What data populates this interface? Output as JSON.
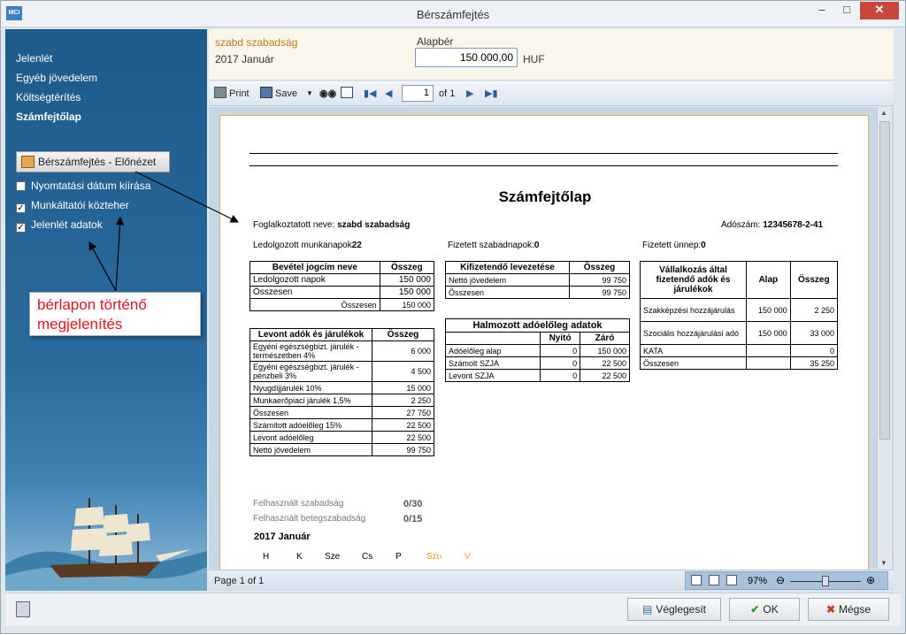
{
  "window": {
    "title": "Bérszámfejtés",
    "logo": "MCI"
  },
  "sidebar": {
    "items": [
      {
        "label": "Jelenlét",
        "active": false
      },
      {
        "label": "Egyéb jövedelem",
        "active": false
      },
      {
        "label": "Költségtérítés",
        "active": false
      },
      {
        "label": "Számfejtőlap",
        "active": true
      }
    ],
    "preview_button": "Bérszámfejtés - Előnézet",
    "checkboxes": [
      {
        "label": "Nyomtatási dátum kiírása",
        "checked": false
      },
      {
        "label": "Munkáltatói közteher",
        "checked": true
      },
      {
        "label": "Jelenlét adatok",
        "checked": true
      }
    ],
    "callout": "bérlapon történő megjelenítés"
  },
  "header": {
    "employee": "szabd szabadság",
    "period": "2017 Január",
    "alapber_label": "Alapbér",
    "alapber_value": "150 000,00",
    "currency": "HUF"
  },
  "toolbar": {
    "print": "Print",
    "save": "Save",
    "page_current": "1",
    "page_of": "of 1"
  },
  "report": {
    "title": "Számfejtőlap",
    "employee_label": "Foglalkoztatott neve:",
    "employee_name": "szabd szabadság",
    "tax_label": "Adószám:",
    "tax_number": "12345678-2-41",
    "worked_label": "Ledolgozott munkanapok",
    "worked_value": "22",
    "paid_leave_label": "Fizetett szabadnapok:",
    "paid_leave_value": "0",
    "paid_holiday_label": "Fizetett ünnep:",
    "paid_holiday_value": "0",
    "income_table": {
      "headers": [
        "Bevétel jogcím neve",
        "Összeg"
      ],
      "rows": [
        [
          "Ledolgozott napok",
          "150 000"
        ],
        [
          "Összesen",
          "150 000"
        ]
      ],
      "total_label": "Összesen",
      "total_value": "150 000"
    },
    "deductions_table": {
      "headers": [
        "Levont adók és járulékok",
        "Összeg"
      ],
      "rows": [
        [
          "Egyéni egészségbizt. járulék - természetben 4%",
          "6 000"
        ],
        [
          "Egyéni egészségbizt. járulék - pénzbeli 3%",
          "4 500"
        ],
        [
          "Nyugdíjjárulék 10%",
          "15 000"
        ],
        [
          "Munkaerőpiaci járulék 1,5%",
          "2 250"
        ],
        [
          "Összesen",
          "27 750"
        ],
        [
          "Számított adóelőleg 15%",
          "22 500"
        ],
        [
          "Levont adóelőleg",
          "22 500"
        ],
        [
          "Nettó jövedelem",
          "99 750"
        ]
      ]
    },
    "payout_table": {
      "headers": [
        "Kifizetendő levezetése",
        "Összeg"
      ],
      "rows": [
        [
          "Nettó jövedelem",
          "99 750"
        ],
        [
          "Összesen",
          "99 750"
        ]
      ]
    },
    "advance_table": {
      "title": "Halmozott adóelőleg adatok",
      "headers": [
        "",
        "Nyitó",
        "Záró"
      ],
      "rows": [
        [
          "Adóelőleg alap",
          "0",
          "150 000"
        ],
        [
          "Számolt SZJA",
          "0",
          "22 500"
        ],
        [
          "Levont SZJA",
          "0",
          "22 500"
        ]
      ]
    },
    "employer_table": {
      "headers": [
        "Vállalkozás által fizetendő adók és járulékok",
        "Alap",
        "Összeg"
      ],
      "rows": [
        [
          "Szakképzési hozzájárulás",
          "150 000",
          "2 250"
        ],
        [
          "Szociális hozzájárulási adó",
          "150 000",
          "33 000"
        ],
        [
          "KATA",
          "",
          "0"
        ],
        [
          "Összesen",
          "",
          "35 250"
        ]
      ]
    },
    "used_leave_label": "Felhasznált szabadság",
    "used_leave_value": "0/30",
    "used_sick_label": "Felhasznált betegszabadság",
    "used_sick_value": "0/15",
    "calendar_month": "2017 Január",
    "calendar_days": [
      "H",
      "K",
      "Sze",
      "Cs",
      "P",
      "Szo",
      "V"
    ]
  },
  "statusbar": {
    "page": "Page 1 of 1",
    "zoom": "97%"
  },
  "footer": {
    "finalize": "Véglegesít",
    "ok": "OK",
    "cancel": "Mégse"
  },
  "colors": {
    "sidebar": "#1e5a8c",
    "callout_text": "#e0141e",
    "weekend": "#e8a020"
  }
}
